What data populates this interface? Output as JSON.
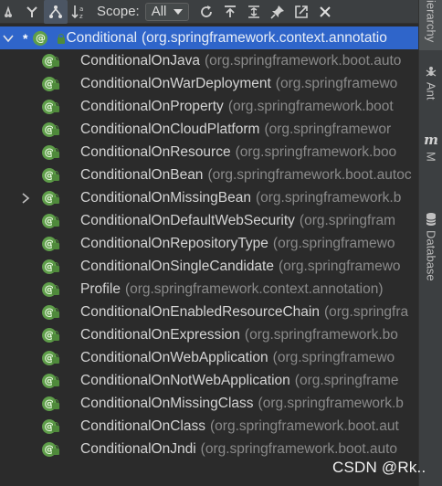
{
  "toolbar": {
    "scope_label": "Scope:",
    "scope_value": "All",
    "buttons": [
      "subtypes-hierarchy-icon",
      "supertypes-hierarchy-icon",
      "class-hierarchy-icon",
      "sort-alphabetically-icon",
      "refresh-icon",
      "autoscroll-to-source-icon",
      "expand-all-icon",
      "pin-icon",
      "open-in-new-window-icon",
      "close-icon"
    ]
  },
  "side_tabs": {
    "hierarchy": "ierarchy",
    "ant": "Ant",
    "maven": "M",
    "database": "Database"
  },
  "tree": {
    "root": {
      "marker": "*",
      "name": "Conditional",
      "pkg": "(org.springframework.context.annotatio"
    },
    "children": [
      {
        "name": "ConditionalOnJava",
        "pkg": "(org.springframework.boot.auto"
      },
      {
        "name": "ConditionalOnWarDeployment",
        "pkg": "(org.springframewo"
      },
      {
        "name": "ConditionalOnProperty",
        "pkg": "(org.springframework.boot"
      },
      {
        "name": "ConditionalOnCloudPlatform",
        "pkg": "(org.springframewor"
      },
      {
        "name": "ConditionalOnResource",
        "pkg": "(org.springframework.boo"
      },
      {
        "name": "ConditionalOnBean",
        "pkg": "(org.springframework.boot.autoc"
      },
      {
        "name": "ConditionalOnMissingBean",
        "pkg": "(org.springframework.b",
        "expandable": true
      },
      {
        "name": "ConditionalOnDefaultWebSecurity",
        "pkg": "(org.springfram"
      },
      {
        "name": "ConditionalOnRepositoryType",
        "pkg": "(org.springframewo"
      },
      {
        "name": "ConditionalOnSingleCandidate",
        "pkg": "(org.springframewo"
      },
      {
        "name": "Profile",
        "pkg": "(org.springframework.context.annotation)"
      },
      {
        "name": "ConditionalOnEnabledResourceChain",
        "pkg": "(org.springfra"
      },
      {
        "name": "ConditionalOnExpression",
        "pkg": "(org.springframework.bo"
      },
      {
        "name": "ConditionalOnWebApplication",
        "pkg": "(org.springframewo"
      },
      {
        "name": "ConditionalOnNotWebApplication",
        "pkg": "(org.springframe"
      },
      {
        "name": "ConditionalOnMissingClass",
        "pkg": "(org.springframework.b"
      },
      {
        "name": "ConditionalOnClass",
        "pkg": "(org.springframework.boot.aut"
      },
      {
        "name": "ConditionalOnJndi",
        "pkg": "(org.springframework.boot.auto"
      }
    ]
  },
  "watermark": "CSDN @Rk..",
  "colors": {
    "selection": "#2f65ca",
    "annotation_icon": "#5f9e4a",
    "background": "#2b2b2b",
    "toolbar": "#3c3f41"
  }
}
